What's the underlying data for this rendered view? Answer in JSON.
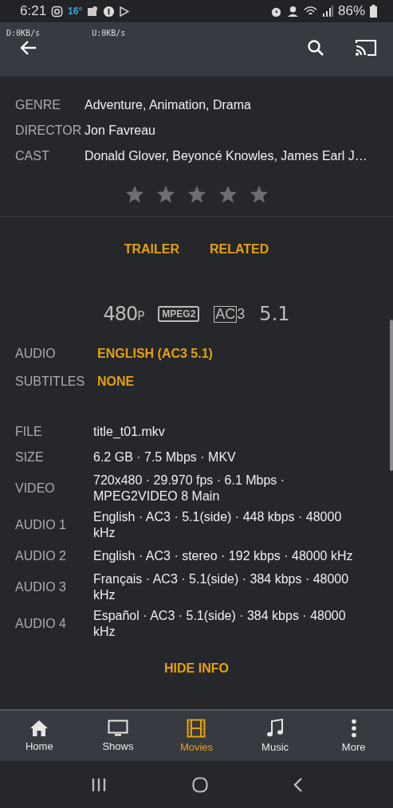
{
  "status_bar": {
    "time": "6:21",
    "temperature": "16°",
    "battery": "86%"
  },
  "net_speed": {
    "download": "D:0KB/s",
    "upload": "U:0KB/s"
  },
  "meta": [
    {
      "label": "GENRE",
      "value": "Adventure, Animation, Drama"
    },
    {
      "label": "DIRECTOR",
      "value": "Jon Favreau"
    },
    {
      "label": "CAST",
      "value": "Donald Glover, Beyoncé Knowles, James Earl J…"
    }
  ],
  "rating": {
    "stars": 0
  },
  "actions": [
    "TRAILER",
    "RELATED"
  ],
  "format_badges": [
    {
      "kind": "resolution",
      "text": "480",
      "suffix": "P"
    },
    {
      "kind": "boxed",
      "text": "MPEG2"
    },
    {
      "kind": "half-boxed",
      "text": "AC",
      "suffix": "3"
    },
    {
      "kind": "plain",
      "text": "5.1"
    }
  ],
  "streams": [
    {
      "label": "AUDIO",
      "value": "ENGLISH (AC3 5.1)"
    },
    {
      "label": "SUBTITLES",
      "value": "NONE"
    }
  ],
  "details": [
    {
      "label": "FILE",
      "value": "title_t01.mkv"
    },
    {
      "label": "SIZE",
      "value": "6.2 GB · 7.5 Mbps · MKV"
    },
    {
      "label": "VIDEO",
      "value": "720x480 · 29.970 fps · 6.1 Mbps · MPEG2VIDEO 8 Main"
    },
    {
      "label": "AUDIO 1",
      "value": "English · AC3 · 5.1(side) · 448 kbps · 48000 kHz"
    },
    {
      "label": "AUDIO 2",
      "value": "English · AC3 · stereo · 192 kbps · 48000 kHz"
    },
    {
      "label": "AUDIO 3",
      "value": "Français · AC3 · 5.1(side) · 384 kbps · 48000 kHz"
    },
    {
      "label": "AUDIO 4",
      "value": "Español · AC3 · 5.1(side) · 384 kbps · 48000 kHz"
    }
  ],
  "hide_info": "HIDE INFO",
  "bottom_nav": [
    {
      "kind": "home",
      "label": "Home",
      "selected": false
    },
    {
      "kind": "tv",
      "label": "Shows",
      "selected": false
    },
    {
      "kind": "film",
      "label": "Movies",
      "selected": true
    },
    {
      "kind": "music",
      "label": "Music",
      "selected": false
    },
    {
      "kind": "more",
      "label": "More",
      "selected": false
    }
  ]
}
